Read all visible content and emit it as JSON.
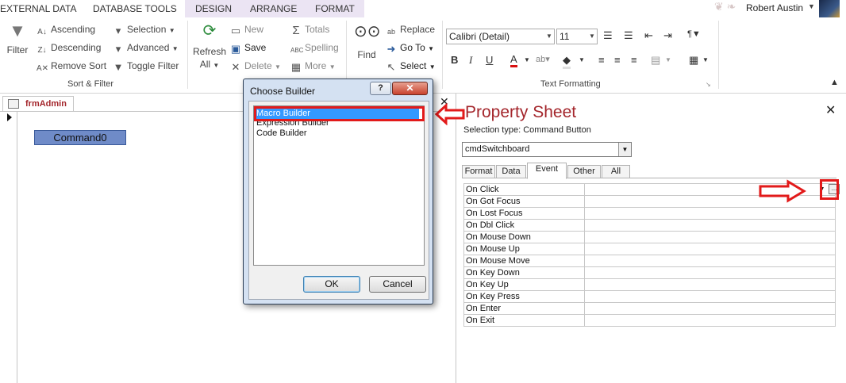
{
  "ribbon_tabs": [
    "EXTERNAL DATA",
    "DATABASE TOOLS",
    "DESIGN",
    "ARRANGE",
    "FORMAT"
  ],
  "user_name": "Robert Austin",
  "sort_filter": {
    "filter_label": "Filter",
    "ascending": "Ascending",
    "descending": "Descending",
    "remove_sort": "Remove Sort",
    "selection": "Selection",
    "advanced": "Advanced",
    "toggle_filter": "Toggle Filter",
    "group_label": "Sort & Filter"
  },
  "records": {
    "refresh_label": "Refresh",
    "refresh_all": "All",
    "new": "New",
    "save": "Save",
    "delete": "Delete",
    "totals": "Totals",
    "spelling": "Spelling",
    "more": "More"
  },
  "find": {
    "find_label": "Find",
    "replace": "Replace",
    "go_to": "Go To",
    "select": "Select"
  },
  "text_formatting": {
    "font": "Calibri (Detail)",
    "size": "11",
    "group_label": "Text Formatting"
  },
  "document": {
    "tab_label": "frmAdmin",
    "command_button": "Command0"
  },
  "dialog": {
    "title": "Choose Builder",
    "help": "?",
    "close": "✕",
    "items": [
      "Macro Builder",
      "Expression Builder",
      "Code Builder"
    ],
    "ok": "OK",
    "cancel": "Cancel"
  },
  "property_sheet": {
    "title": "Property Sheet",
    "selection_type_label": "Selection type:  Command Button",
    "object": "cmdSwitchboard",
    "tabs": [
      "Format",
      "Data",
      "Event",
      "Other",
      "All"
    ],
    "active_tab": "Event",
    "events": [
      "On Click",
      "On Got Focus",
      "On Lost Focus",
      "On Dbl Click",
      "On Mouse Down",
      "On Mouse Up",
      "On Mouse Move",
      "On Key Down",
      "On Key Up",
      "On Key Press",
      "On Enter",
      "On Exit"
    ],
    "build_button": "..."
  },
  "annotation_color": "#e21a1a"
}
